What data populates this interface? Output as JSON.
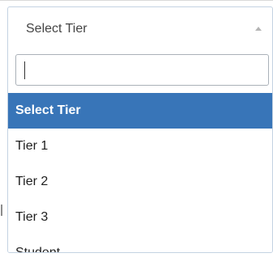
{
  "tier_select": {
    "selected_value": "Select Tier",
    "search": {
      "value": "",
      "placeholder": ""
    },
    "options": [
      {
        "label": "Select Tier",
        "selected": true
      },
      {
        "label": "Tier 1",
        "selected": false
      },
      {
        "label": "Tier 2",
        "selected": false
      },
      {
        "label": "Tier 3",
        "selected": false
      },
      {
        "label": "Student",
        "selected": false
      }
    ]
  },
  "colors": {
    "selected_option_bg": "#3875b8",
    "selected_option_text": "#ffffff",
    "option_text": "#1f1f1f",
    "box_border": "#c3d2e2",
    "search_border": "#aab1b8",
    "arrow": "#b5b5b5"
  },
  "icons": {
    "dropdown_arrow": "chevron-up-icon"
  }
}
